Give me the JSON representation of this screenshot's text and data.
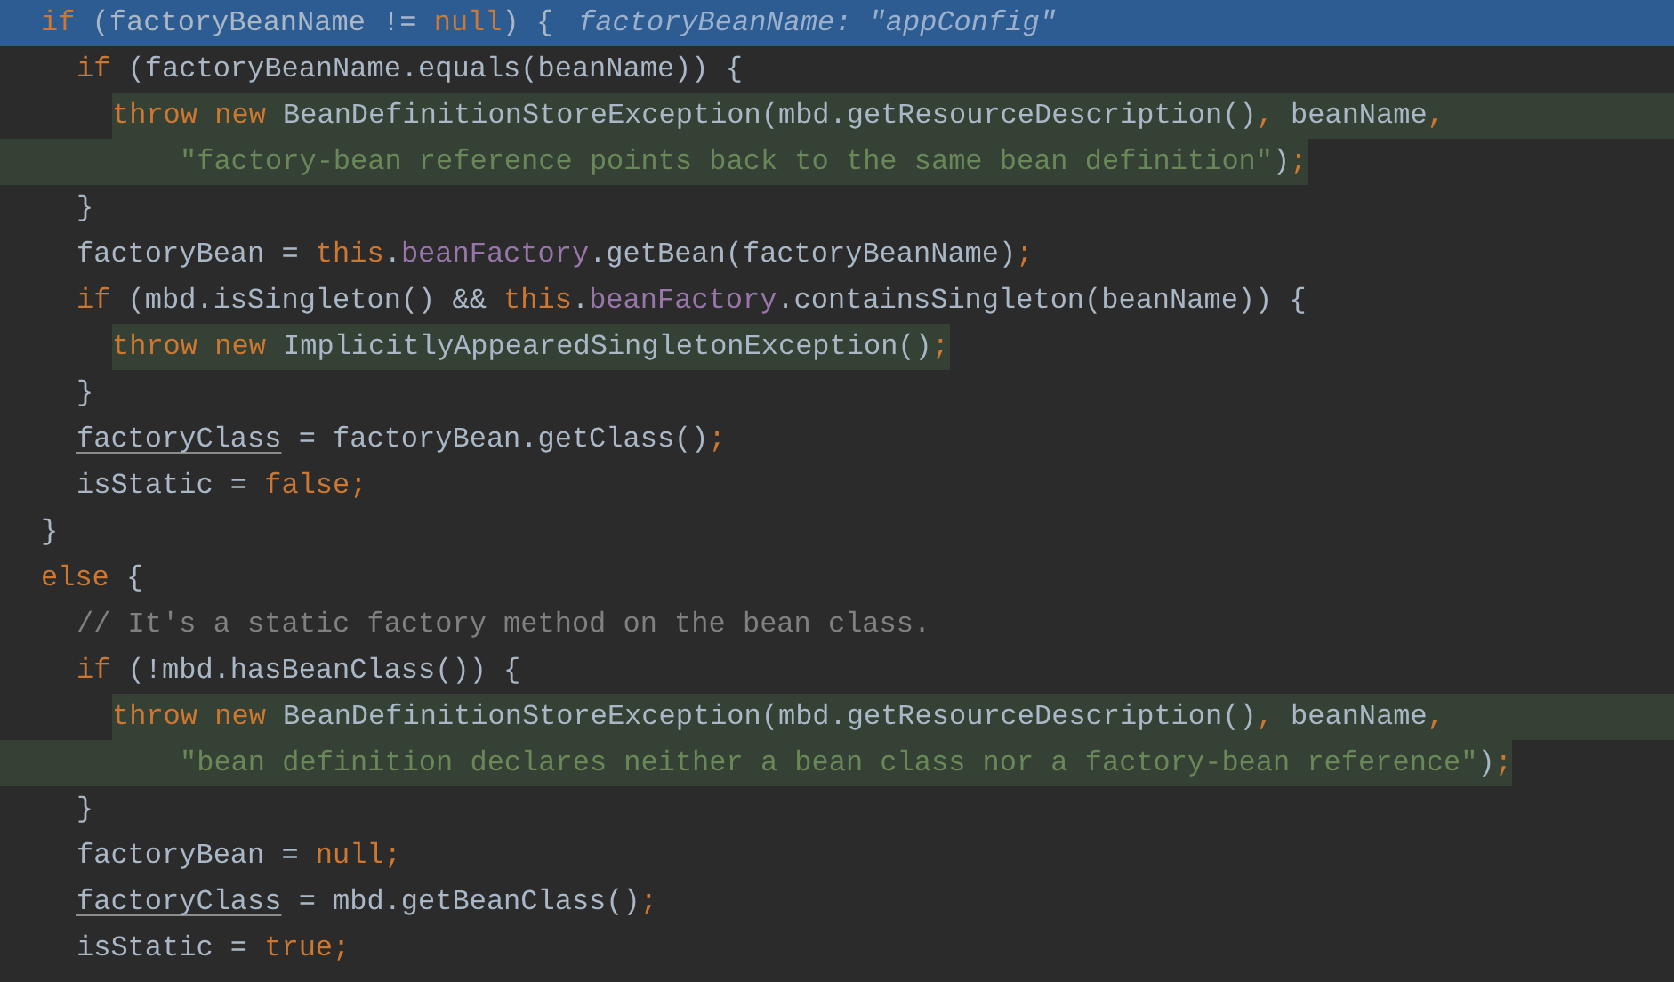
{
  "editor": {
    "lines": [
      {
        "current": true,
        "inline_hint": "factoryBeanName: \"appConfig\"",
        "tokens": [
          {
            "kind": "keyword",
            "text": "if"
          },
          {
            "kind": "plain",
            "text": " (factoryBeanName != "
          },
          {
            "kind": "keyword",
            "text": "null"
          },
          {
            "kind": "plain",
            "text": ") {"
          }
        ],
        "children": [
          {
            "tokens": [
              {
                "kind": "keyword",
                "text": "if"
              },
              {
                "kind": "plain",
                "text": " (factoryBeanName.equals(beanName)) {"
              }
            ],
            "children": [
              {
                "flagged": true,
                "tokens": [
                  {
                    "kind": "keyword",
                    "text": "throw new"
                  },
                  {
                    "kind": "plain",
                    "text": " BeanDefinitionStoreException(mbd.getResourceDescription()"
                  },
                  {
                    "kind": "punct",
                    "text": ","
                  },
                  {
                    "kind": "plain",
                    "text": " beanName"
                  },
                  {
                    "kind": "punct",
                    "text": ","
                  }
                ],
                "children": [
                  {
                    "continuation": true,
                    "flagged": true,
                    "tokens": [
                      {
                        "kind": "string",
                        "text": "\"factory-bean reference points back to the same bean definition\""
                      },
                      {
                        "kind": "plain",
                        "text": ")"
                      },
                      {
                        "kind": "punct",
                        "text": ";"
                      }
                    ]
                  }
                ]
              }
            ]
          },
          {
            "tokens": [
              {
                "kind": "plain",
                "text": "}"
              }
            ]
          },
          {
            "tokens": [
              {
                "kind": "plain",
                "text": "factoryBean = "
              },
              {
                "kind": "keyword",
                "text": "this"
              },
              {
                "kind": "plain",
                "text": "."
              },
              {
                "kind": "field",
                "text": "beanFactory"
              },
              {
                "kind": "plain",
                "text": ".getBean(factoryBeanName)"
              },
              {
                "kind": "punct",
                "text": ";"
              }
            ]
          },
          {
            "tokens": [
              {
                "kind": "keyword",
                "text": "if"
              },
              {
                "kind": "plain",
                "text": " (mbd.isSingleton() && "
              },
              {
                "kind": "keyword",
                "text": "this"
              },
              {
                "kind": "plain",
                "text": "."
              },
              {
                "kind": "field",
                "text": "beanFactory"
              },
              {
                "kind": "plain",
                "text": ".containsSingleton(beanName)) {"
              }
            ],
            "children": [
              {
                "flagged": true,
                "tokens": [
                  {
                    "kind": "keyword",
                    "text": "throw new"
                  },
                  {
                    "kind": "plain",
                    "text": " ImplicitlyAppearedSingletonException()"
                  },
                  {
                    "kind": "punct",
                    "text": ";"
                  }
                ]
              }
            ]
          },
          {
            "tokens": [
              {
                "kind": "plain",
                "text": "}"
              }
            ]
          },
          {
            "tokens": [
              {
                "kind": "reassigned",
                "text": "factoryClass"
              },
              {
                "kind": "plain",
                "text": " = factoryBean.getClass()"
              },
              {
                "kind": "punct",
                "text": ";"
              }
            ]
          },
          {
            "tokens": [
              {
                "kind": "plain",
                "text": "isStatic = "
              },
              {
                "kind": "keyword",
                "text": "false;"
              }
            ]
          }
        ]
      },
      {
        "tokens": [
          {
            "kind": "plain",
            "text": "}"
          }
        ]
      },
      {
        "tokens": [
          {
            "kind": "keyword",
            "text": "else"
          },
          {
            "kind": "plain",
            "text": " {"
          }
        ],
        "children": [
          {
            "tokens": [
              {
                "kind": "comment",
                "text": "// It's a static factory method on the bean class."
              }
            ]
          },
          {
            "tokens": [
              {
                "kind": "keyword",
                "text": "if"
              },
              {
                "kind": "plain",
                "text": " (!mbd.hasBeanClass()) {"
              }
            ],
            "children": [
              {
                "flagged": true,
                "tokens": [
                  {
                    "kind": "keyword",
                    "text": "throw new"
                  },
                  {
                    "kind": "plain",
                    "text": " BeanDefinitionStoreException(mbd.getResourceDescription()"
                  },
                  {
                    "kind": "punct",
                    "text": ","
                  },
                  {
                    "kind": "plain",
                    "text": " beanName"
                  },
                  {
                    "kind": "punct",
                    "text": ","
                  }
                ],
                "children": [
                  {
                    "continuation": true,
                    "flagged": true,
                    "tokens": [
                      {
                        "kind": "string",
                        "text": "\"bean definition declares neither a bean class nor a factory-bean reference\""
                      },
                      {
                        "kind": "plain",
                        "text": ")"
                      },
                      {
                        "kind": "punct",
                        "text": ";"
                      }
                    ]
                  }
                ]
              }
            ]
          },
          {
            "tokens": [
              {
                "kind": "plain",
                "text": "}"
              }
            ]
          },
          {
            "tokens": [
              {
                "kind": "plain",
                "text": "factoryBean = "
              },
              {
                "kind": "keyword",
                "text": "null;"
              }
            ]
          },
          {
            "tokens": [
              {
                "kind": "reassigned",
                "text": "factoryClass"
              },
              {
                "kind": "plain",
                "text": " = mbd.getBeanClass()"
              },
              {
                "kind": "punct",
                "text": ";"
              }
            ]
          },
          {
            "tokens": [
              {
                "kind": "plain",
                "text": "isStatic = "
              },
              {
                "kind": "keyword",
                "text": "true;"
              }
            ]
          }
        ]
      }
    ]
  }
}
